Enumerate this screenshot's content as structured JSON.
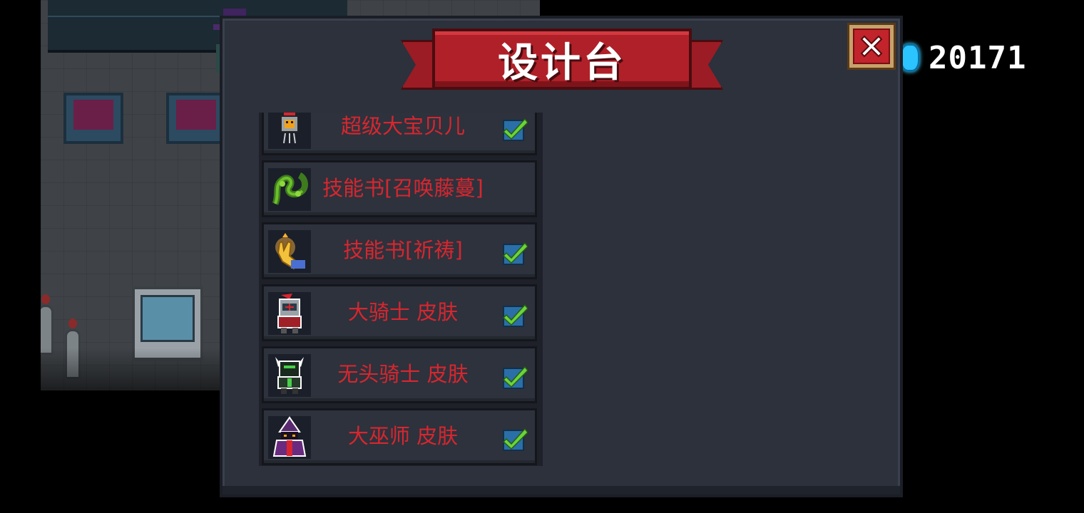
{
  "header": {
    "title": "设计台",
    "close_icon": "close-x-icon"
  },
  "currency": {
    "icon": "gem-icon",
    "amount": "20171"
  },
  "recipes": [
    {
      "name": "超级大宝贝儿",
      "icon": "robot-pet-icon",
      "checked": true
    },
    {
      "name": "技能书[召唤藤蔓]",
      "icon": "vine-skillbook-icon",
      "checked": false
    },
    {
      "name": "技能书[祈祷]",
      "icon": "prayer-hand-icon",
      "checked": true
    },
    {
      "name": "大骑士 皮肤",
      "icon": "knight-skin-icon",
      "checked": true
    },
    {
      "name": "无头骑士 皮肤",
      "icon": "headless-knight-skin-icon",
      "checked": true
    },
    {
      "name": "大巫师 皮肤",
      "icon": "wizard-skin-icon",
      "checked": true
    }
  ],
  "colors": {
    "panel": "#2c313c",
    "ribbon": "#b02028",
    "label": "#d8262e",
    "check": "#6ad43a"
  }
}
